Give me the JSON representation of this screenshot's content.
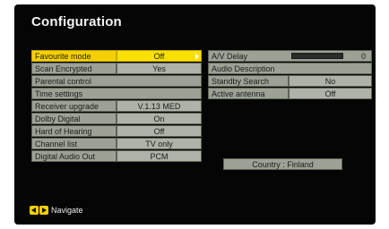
{
  "screen": {
    "title": "Configuration"
  },
  "left_menu": [
    {
      "label": "Favourite mode",
      "value": "Off",
      "selected": true
    },
    {
      "label": "Scan Encrypted",
      "value": "Yes"
    },
    {
      "label": "Parental control",
      "value": ""
    },
    {
      "label": "Time settings",
      "value": ""
    },
    {
      "label": "Receiver upgrade",
      "value": "V.1.13 MED"
    },
    {
      "label": "Dolby Digital",
      "value": "On"
    },
    {
      "label": "Hard of Hearing",
      "value": "Off"
    },
    {
      "label": "Channel list",
      "value": "TV only"
    },
    {
      "label": "Digital Audio Out",
      "value": "PCM"
    }
  ],
  "right_menu": {
    "av_delay": {
      "label": "A/V Delay",
      "value": "0",
      "level": 0.0
    },
    "audio_description": {
      "label": "Audio Description"
    },
    "standby_search": {
      "label": "Standby Search",
      "value": "No"
    },
    "active_antenna": {
      "label": "Active antenna",
      "value": "Off"
    }
  },
  "country": "Country : Finland",
  "footer": {
    "nav_label": "Navigate",
    "nav_icon": "left-right-arrow-keys"
  },
  "colors": {
    "selected": "#f5d000",
    "cell": "#9ba195",
    "background": "#050505"
  }
}
